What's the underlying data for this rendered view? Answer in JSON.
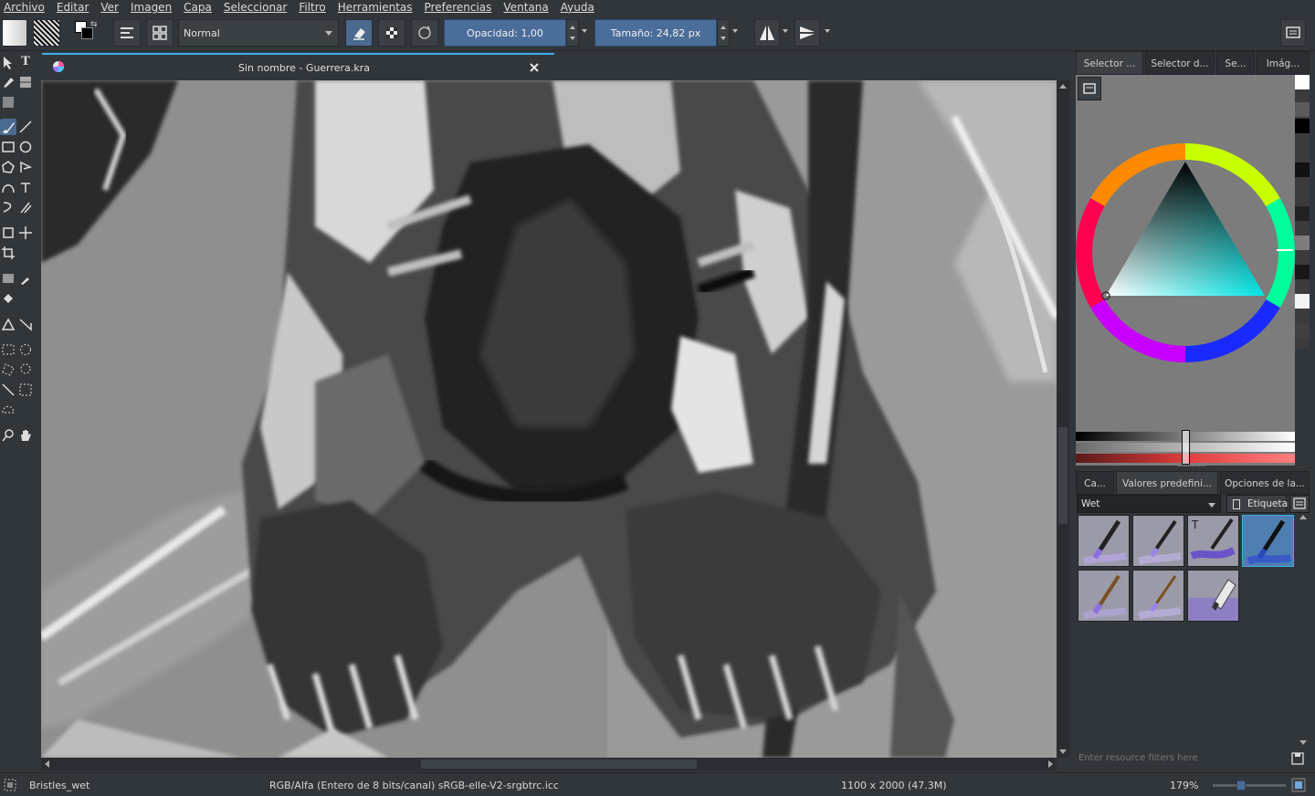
{
  "menu": [
    "Archivo",
    "Editar",
    "Ver",
    "Imagen",
    "Capa",
    "Seleccionar",
    "Filtro",
    "Herramientas",
    "Preferencias",
    "Ventana",
    "Ayuda"
  ],
  "toolbar": {
    "blend_mode": "Normal",
    "opacity_label": "Opacidad:  1,00",
    "size_label": "Tamaño:  24,82 px"
  },
  "document": {
    "tab_title": "Sin nombre - Guerrera.kra"
  },
  "dock": {
    "tabs_top": [
      "Selector ...",
      "Selector d...",
      "Se...",
      "Imág..."
    ],
    "tabs_bottom": [
      "Ca...",
      "Valores predefini...",
      "Opciones de la..."
    ],
    "preset_tag": "Wet",
    "tag_button": "Etiqueta",
    "filter_placeholder": "Enter resource filters here"
  },
  "status": {
    "brush": "Bristles_wet",
    "color_space": "RGB/Alfa (Entero de 8 bits/canal)  sRGB-elle-V2-srgbtrc.icc",
    "dimensions": "1100 x 2000 (47.3M)",
    "zoom": "179%"
  },
  "colors": {
    "accent": "#3daee9",
    "active_button": "#4a6a8f",
    "panel_bg": "#31363b"
  }
}
